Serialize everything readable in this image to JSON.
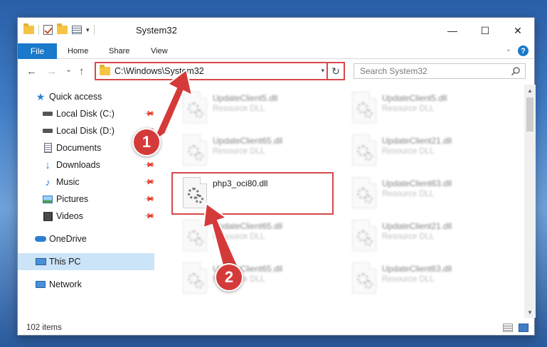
{
  "window": {
    "title": "System32",
    "controls": {
      "minimize": "—",
      "maximize": "☐",
      "close": "✕"
    }
  },
  "ribbon": {
    "tabs": [
      {
        "label": "File"
      },
      {
        "label": "Home"
      },
      {
        "label": "Share"
      },
      {
        "label": "View"
      }
    ],
    "help": "?"
  },
  "navigation": {
    "back": "←",
    "forward": "→",
    "recent": "⌄",
    "up": "↑",
    "address": "C:\\Windows\\System32",
    "search_placeholder": "Search System32"
  },
  "sidebar": {
    "items": [
      {
        "label": "Quick access",
        "icon": "star-icon",
        "pinned": false
      },
      {
        "label": "Local Disk (C:)",
        "icon": "drive-icon",
        "pinned": true
      },
      {
        "label": "Local Disk (D:)",
        "icon": "drive-icon",
        "pinned": true
      },
      {
        "label": "Documents",
        "icon": "document-icon",
        "pinned": true
      },
      {
        "label": "Downloads",
        "icon": "download-icon",
        "pinned": true
      },
      {
        "label": "Music",
        "icon": "music-icon",
        "pinned": true
      },
      {
        "label": "Pictures",
        "icon": "pictures-icon",
        "pinned": true
      },
      {
        "label": "Videos",
        "icon": "video-icon",
        "pinned": true
      },
      {
        "label": "OneDrive",
        "icon": "cloud-icon",
        "pinned": false
      },
      {
        "label": "This PC",
        "icon": "computer-icon",
        "pinned": false,
        "selected": true
      },
      {
        "label": "Network",
        "icon": "network-icon",
        "pinned": false
      }
    ]
  },
  "files": [
    {
      "name": "UpdateClient5.dll",
      "type": "Resource DLL"
    },
    {
      "name": "UpdateClient5.dll",
      "type": "Resource DLL"
    },
    {
      "name": "UpdateClient65.dll",
      "type": "Resource DLL"
    },
    {
      "name": "UpdateClient21.dll",
      "type": "Resource DLL"
    },
    {
      "name": "php3_oci80.dll",
      "type": ""
    },
    {
      "name": "UpdateClient63.dll",
      "type": "Resource DLL"
    },
    {
      "name": "UpdateClient65.dll",
      "type": "Resource DLL"
    },
    {
      "name": "UpdateClient21.dll",
      "type": "Resource DLL"
    },
    {
      "name": "UpdateClient65.dll",
      "type": "Resource DLL"
    },
    {
      "name": "UpdateClient63.dll",
      "type": "Resource DLL"
    }
  ],
  "status": {
    "item_count": "102 items"
  },
  "annotations": {
    "badge1": "1",
    "badge2": "2",
    "accent": "#d53a3a"
  }
}
